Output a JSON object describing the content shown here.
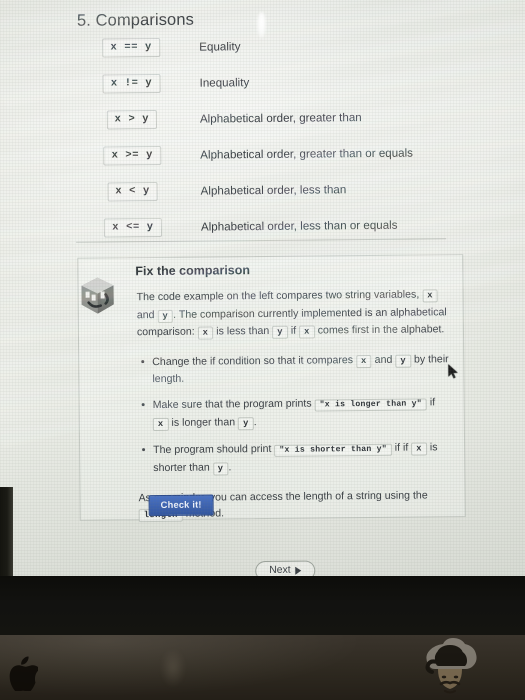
{
  "page": {
    "title": "5. Comparisons"
  },
  "comparison_table": {
    "rows": [
      {
        "code": "x == y",
        "description": "Equality"
      },
      {
        "code": "x != y",
        "description": "Inequality"
      },
      {
        "code": "x > y",
        "description": "Alphabetical order, greater than"
      },
      {
        "code": "x >= y",
        "description": "Alphabetical order, greater than or equals"
      },
      {
        "code": "x < y",
        "description": "Alphabetical order, less than"
      },
      {
        "code": "x <= y",
        "description": "Alphabetical order, less than or equals"
      }
    ]
  },
  "exercise": {
    "icon": "cube-icon",
    "title": "Fix the comparison",
    "intro": {
      "p1": "The code example on the left compares two string variables,",
      "var_x1": "x",
      "and1": "and",
      "var_y1": "y",
      "p2": ". The comparison currently implemented is an alphabetical comparison:",
      "var_x2": "x",
      "p3": "is less than",
      "var_y2": "y",
      "p4": "if",
      "var_x3": "x",
      "p5": "comes first in the alphabet."
    },
    "bullets": [
      {
        "t1": "Change the if condition so that it compares",
        "c1": "x",
        "t2": "and",
        "c2": "y",
        "t3": "by their length."
      },
      {
        "t1": "Make sure that the program prints",
        "c1": "\"x is longer than y\"",
        "t2": "if",
        "c2": "x",
        "t3": "is longer than",
        "c3": "y",
        "t4": "."
      },
      {
        "t1": "The program should print",
        "c1": "\"x is shorter than y\"",
        "t2": "if if",
        "c2": "x",
        "t3": "is shorter than",
        "c3": "y",
        "t4": "."
      }
    ],
    "reminder": {
      "t1": "As a reminder, you can access the length of a string using the",
      "c1": "length",
      "t2": "method."
    },
    "check_button": "Check it!"
  },
  "navigation": {
    "next_button": "Next",
    "next_icon": "play-triangle-icon"
  },
  "colors": {
    "check_button_bg": "#32569f",
    "page_bg": "#e9ebe5",
    "text": "#3a3f44",
    "bezel": "#121210",
    "deck": "#2e2920"
  },
  "photo_elements": {
    "cursor": "mouse-pointer-icon",
    "apple_logo": "apple-logo-icon",
    "sticker": "face-sticker"
  }
}
